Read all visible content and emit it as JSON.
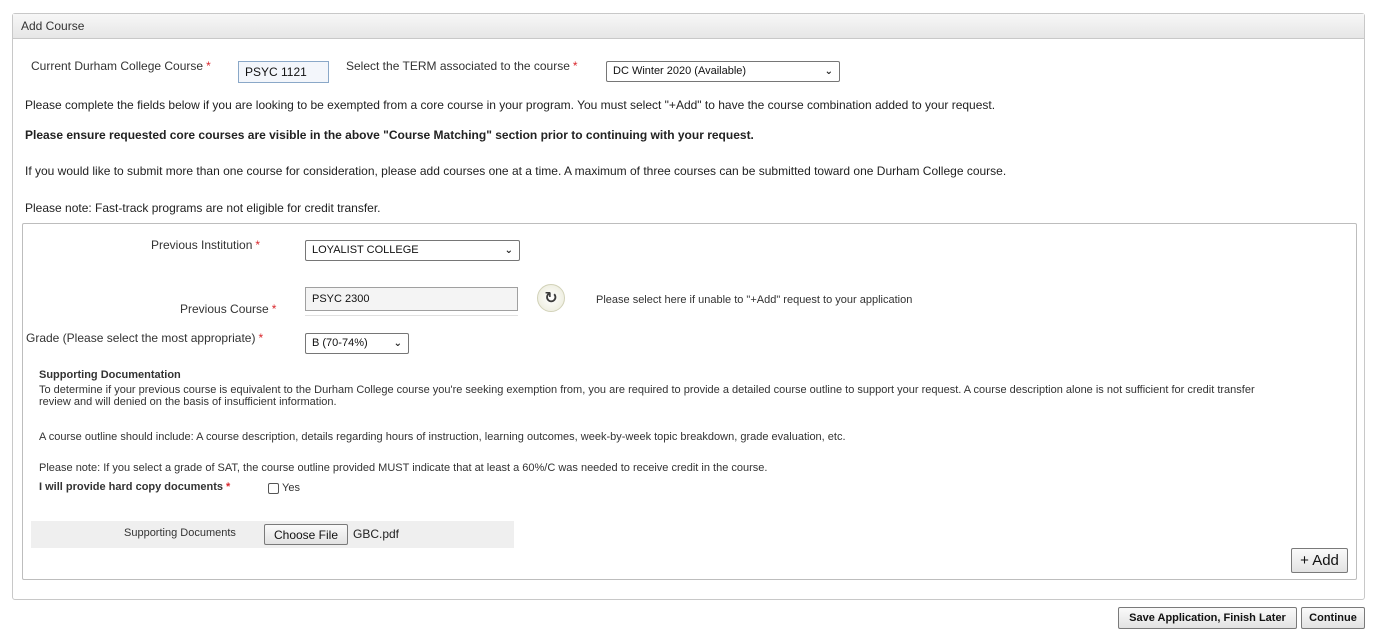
{
  "panel": {
    "title": "Add Course"
  },
  "form": {
    "current_course_label": "Current Durham College Course",
    "current_course_value": "PSYC 1121",
    "term_label": "Select the TERM associated to the course",
    "term_value": "DC Winter 2020 (Available)",
    "required_mark": "*"
  },
  "instructions": {
    "line1": "Please complete the fields below if you are looking to be exempted from a core course in your program. You must select \"+Add\" to have the course combination added to your request.",
    "line2": "Please ensure requested core courses are visible in the above \"Course Matching\" section prior to continuing with your request.",
    "line3": "If you would like to submit more than one course for consideration, please add courses one at a time. A maximum of three courses can be submitted toward one Durham College course.",
    "line4": "Please note: Fast-track programs are not eligible for credit transfer."
  },
  "detail": {
    "prev_institution_label": "Previous Institution",
    "prev_institution_value": "LOYALIST COLLEGE",
    "prev_course_label": "Previous Course",
    "prev_course_value": "PSYC 2300",
    "refresh_hint": "Please select here if unable to \"+Add\" request to your application",
    "grade_label": "Grade (Please select the most appropriate)",
    "grade_value": "B (70-74%)",
    "support_heading": "Supporting Documentation",
    "support_text_1": "To determine if your previous course is equivalent to the Durham College course you're seeking exemption from, you are required to provide a detailed course outline to support your request. A course description alone is not sufficient for credit transfer",
    "support_text_2": "review and will denied on the basis of insufficient information.",
    "outline_text": "A course outline should include: A course description, details regarding hours of instruction, learning outcomes, week-by-week topic breakdown, grade evaluation, etc.",
    "sat_note": "Please note: If you select a grade of SAT, the course outline provided MUST indicate that at least a 60%/C was needed to receive credit in the course.",
    "hard_copy_label": "I will provide hard copy documents",
    "hard_copy_option": "Yes",
    "supporting_docs_label": "Supporting Documents",
    "choose_file_label": "Choose File",
    "file_name": "GBC.pdf",
    "add_button": "+ Add"
  },
  "footer": {
    "save_later": "Save Application, Finish Later",
    "continue": "Continue"
  },
  "icons": {
    "refresh": "refresh-icon",
    "chevron": "chevron-down-icon"
  }
}
